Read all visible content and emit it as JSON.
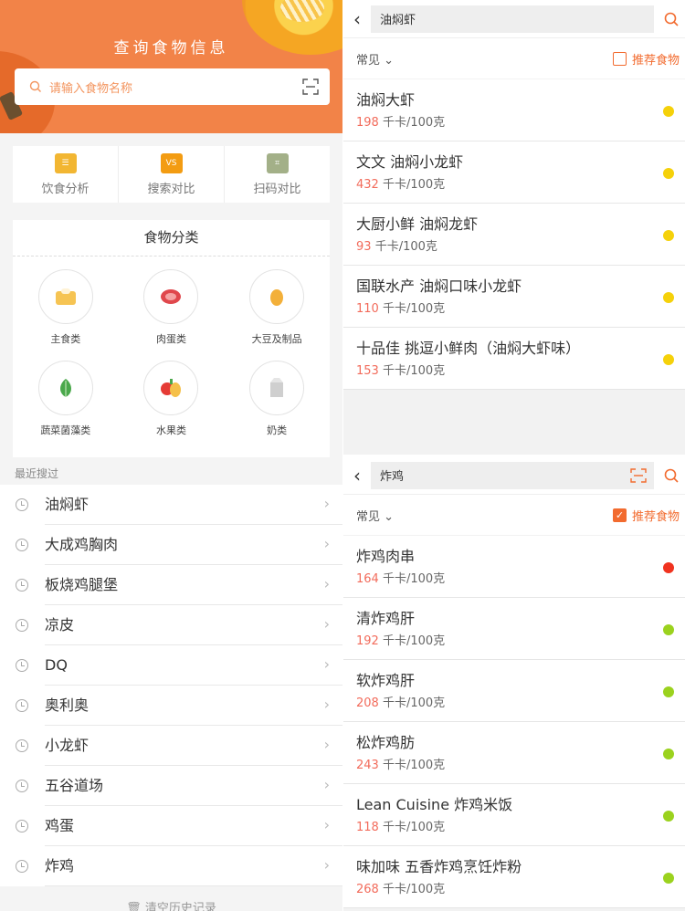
{
  "left": {
    "title": "查询食物信息",
    "search_placeholder": "请输入食物名称",
    "tools": [
      {
        "label": "饮食分析",
        "icon": "diet-analysis-icon",
        "color": "#f2b632"
      },
      {
        "label": "搜索对比",
        "icon": "versus-icon",
        "color": "#f39c12",
        "glyph": "VS"
      },
      {
        "label": "扫码对比",
        "icon": "scan-compare-icon",
        "color": "#a3b088"
      }
    ],
    "category_title": "食物分类",
    "categories": [
      {
        "label": "主食类",
        "icon": "staple-food-icon"
      },
      {
        "label": "肉蛋类",
        "icon": "meat-egg-icon"
      },
      {
        "label": "大豆及制品",
        "icon": "soybean-icon"
      },
      {
        "label": "蔬菜菌藻类",
        "icon": "vegetable-icon"
      },
      {
        "label": "水果类",
        "icon": "fruit-icon"
      },
      {
        "label": "奶类",
        "icon": "milk-icon"
      }
    ],
    "recent_header": "最近搜过",
    "recent": [
      "油焖虾",
      "大成鸡胸肉",
      "板烧鸡腿堡",
      "凉皮",
      "DQ",
      "奥利奥",
      "小龙虾",
      "五谷道场",
      "鸡蛋",
      "炸鸡"
    ],
    "clear_label": "清空历史记录"
  },
  "panel1": {
    "query": "油焖虾",
    "filter": "常见",
    "recommend_label": "推荐食物",
    "recommend_checked": false,
    "unit": "千卡/100克",
    "items": [
      {
        "name": "油焖大虾",
        "kcal": "198",
        "dot": "#f5d10a"
      },
      {
        "name": "文文 油焖小龙虾",
        "kcal": "432",
        "dot": "#f5d10a"
      },
      {
        "name": "大厨小鲜 油焖龙虾",
        "kcal": "93",
        "dot": "#f5d10a"
      },
      {
        "name": "国联水产 油焖口味小龙虾",
        "kcal": "110",
        "dot": "#f5d10a"
      },
      {
        "name": "十品佳 挑逗小鲜肉（油焖大虾味）",
        "kcal": "153",
        "dot": "#f5d10a"
      }
    ]
  },
  "panel2": {
    "query": "炸鸡",
    "filter": "常见",
    "recommend_label": "推荐食物",
    "recommend_checked": true,
    "unit": "千卡/100克",
    "items": [
      {
        "name": "炸鸡肉串",
        "kcal": "164",
        "dot": "#f0331f"
      },
      {
        "name": "清炸鸡肝",
        "kcal": "192",
        "dot": "#9bd21e"
      },
      {
        "name": "软炸鸡肝",
        "kcal": "208",
        "dot": "#9bd21e"
      },
      {
        "name": "松炸鸡肪",
        "kcal": "243",
        "dot": "#9bd21e"
      },
      {
        "name": "Lean Cuisine 炸鸡米饭",
        "kcal": "118",
        "dot": "#9bd21e"
      },
      {
        "name": "味加味 五香炸鸡烹饪炸粉",
        "kcal": "268",
        "dot": "#9bd21e"
      }
    ]
  }
}
